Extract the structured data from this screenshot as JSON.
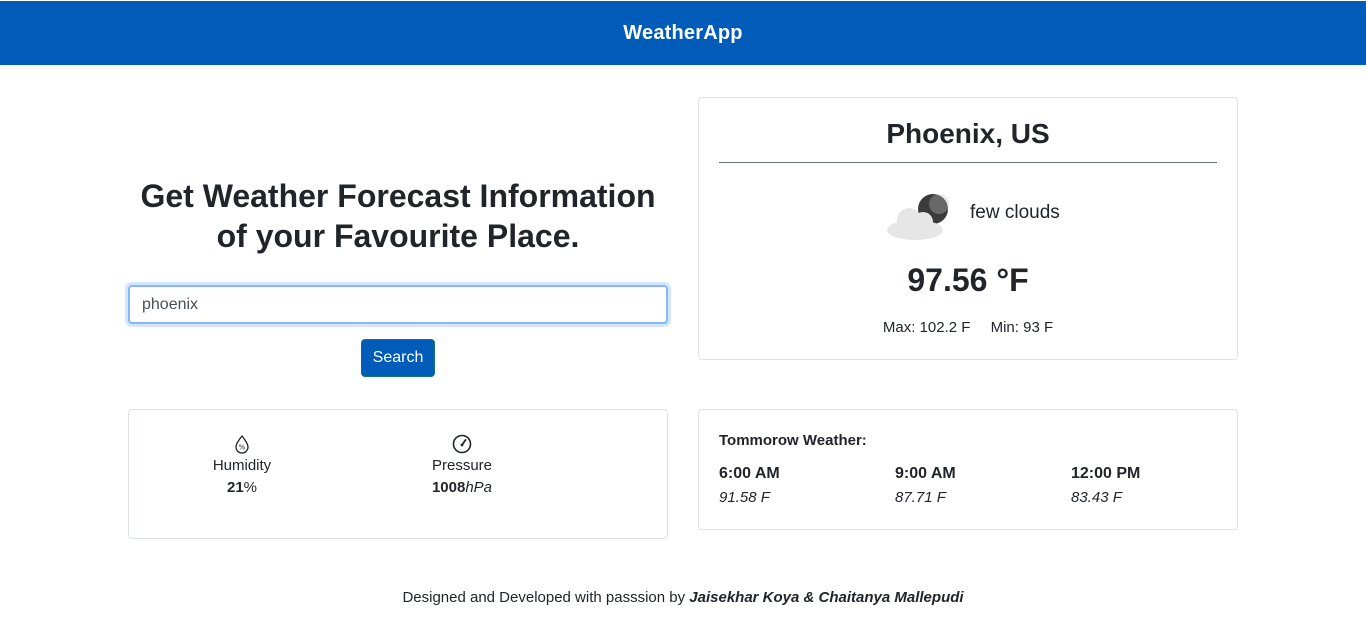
{
  "navbar": {
    "brand": "WeatherApp"
  },
  "hero": {
    "headline": "Get Weather Forecast Information of your Favourite Place."
  },
  "search": {
    "value": "phoenix",
    "button_label": "Search"
  },
  "current": {
    "city": "Phoenix, US",
    "icon": "few-clouds-night-icon",
    "description": "few clouds",
    "temperature": "97.56 °F",
    "max": "Max: 102.2 F",
    "min": "Min: 93 F"
  },
  "stats": {
    "humidity": {
      "label": "Humidity",
      "value": "21",
      "unit": "%",
      "icon": "humidity-drop-icon"
    },
    "pressure": {
      "label": "Pressure",
      "value": "1008",
      "unit": "hPa",
      "icon": "gauge-icon"
    }
  },
  "tomorrow": {
    "title": "Tommorow Weather:",
    "slots": [
      {
        "time": "6:00 AM",
        "temp": "91.58 F"
      },
      {
        "time": "9:00 AM",
        "temp": "87.71 F"
      },
      {
        "time": "12:00 PM",
        "temp": "83.43 F"
      }
    ]
  },
  "footer": {
    "text": "Designed and Developed with passsion by ",
    "authors": "Jaisekhar Koya & Chaitanya Mallepudi"
  },
  "colors": {
    "primary": "#005cb8",
    "border": "#dee2e6",
    "text": "#212529"
  }
}
